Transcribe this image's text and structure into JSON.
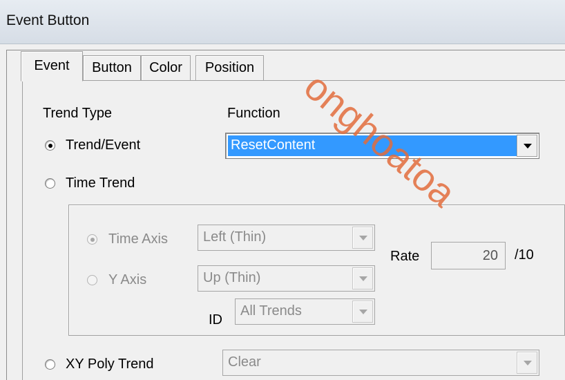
{
  "window": {
    "title": "Event Button"
  },
  "tabs": [
    {
      "label": "Event",
      "active": true
    },
    {
      "label": "Button",
      "active": false
    },
    {
      "label": "Color",
      "active": false
    },
    {
      "label": "Position",
      "active": false
    }
  ],
  "event": {
    "trend_type_label": "Trend Type",
    "function_label": "Function",
    "trend_event": {
      "label": "Trend/Event",
      "checked": true
    },
    "function_combo": {
      "value": "ResetContent"
    },
    "time_trend": {
      "label": "Time Trend",
      "checked": false,
      "time_axis": {
        "label": "Time Axis",
        "value": "Left (Thin)",
        "checked": true
      },
      "y_axis": {
        "label": "Y Axis",
        "value": "Up (Thin)",
        "checked": false
      },
      "id": {
        "label": "ID",
        "value": "All Trends"
      },
      "rate": {
        "label": "Rate",
        "value": "20",
        "unit": "/10"
      }
    },
    "xy_poly": {
      "label": "XY Poly Trend",
      "checked": false,
      "value": "Clear"
    }
  },
  "watermark": "onghoatoa"
}
